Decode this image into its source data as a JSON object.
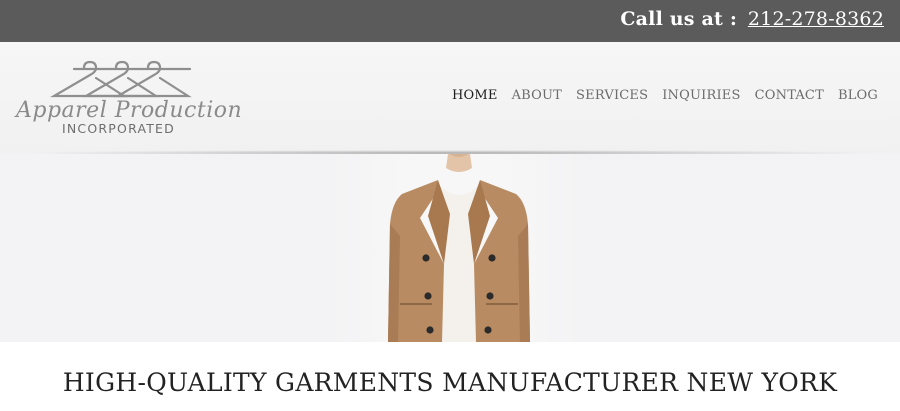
{
  "topbar": {
    "call_label": "Call us at :",
    "phone": "212-278-8362"
  },
  "logo": {
    "script_text": "Apparel Production",
    "sub_text": "INCORPORATED",
    "icon": "hangers-icon"
  },
  "nav": {
    "items": [
      {
        "label": "HOME",
        "active": true
      },
      {
        "label": "ABOUT",
        "active": false
      },
      {
        "label": "SERVICES",
        "active": false
      },
      {
        "label": "INQUIRIES",
        "active": false
      },
      {
        "label": "CONTACT",
        "active": false
      },
      {
        "label": "BLOG",
        "active": false
      }
    ]
  },
  "hero": {
    "image": "model-in-camel-coat",
    "coat_color": "#b98b62",
    "button_color": "#2b2b2b"
  },
  "main": {
    "headline": "HIGH-QUALITY GARMENTS MANUFACTURER NEW YORK"
  },
  "colors": {
    "topbar_bg": "#5b5b5b",
    "header_bg": "#f3f3f3",
    "nav_active": "#1e1e1e",
    "nav_inactive": "#6c6c6c"
  }
}
